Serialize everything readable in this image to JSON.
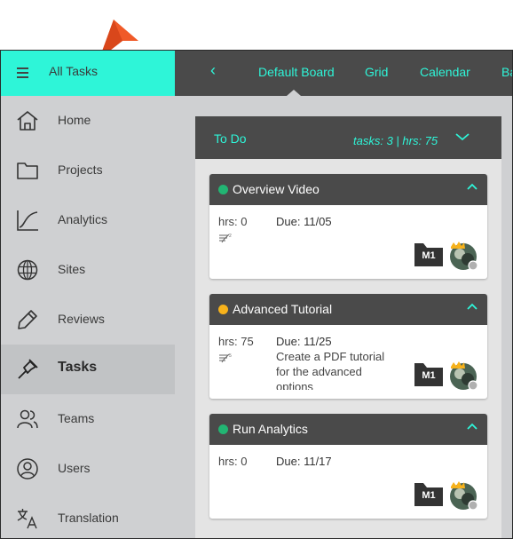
{
  "header": {
    "title": "All Tasks",
    "back_glyph": "‹",
    "tabs": [
      {
        "label": "Default Board"
      },
      {
        "label": "Grid"
      },
      {
        "label": "Calendar"
      },
      {
        "label": "Ba"
      }
    ]
  },
  "sidebar": {
    "items": [
      {
        "label": "Home",
        "icon": "home-icon"
      },
      {
        "label": "Projects",
        "icon": "folder-icon"
      },
      {
        "label": "Analytics",
        "icon": "chart-icon"
      },
      {
        "label": "Sites",
        "icon": "globe-icon"
      },
      {
        "label": "Reviews",
        "icon": "pencil-icon"
      },
      {
        "label": "Tasks",
        "icon": "pin-icon"
      },
      {
        "label": "Teams",
        "icon": "users-icon"
      },
      {
        "label": "Users",
        "icon": "user-circle-icon"
      },
      {
        "label": "Translation",
        "icon": "translate-icon"
      }
    ],
    "active": "Tasks"
  },
  "column": {
    "title": "To Do",
    "stats": "tasks: 3 | hrs: 75"
  },
  "cards": [
    {
      "title": "Overview Video",
      "status_color": "#22b573",
      "hrs": "hrs: 0",
      "due": "Due: 11/05",
      "description": "",
      "badge": "M1"
    },
    {
      "title": "Advanced Tutorial",
      "status_color": "#f7b21b",
      "hrs": "hrs: 75",
      "due": "Due: 11/25",
      "description": "Create a PDF tutorial for the advanced options",
      "badge": "M1"
    },
    {
      "title": "Run Analytics",
      "status_color": "#22b573",
      "hrs": "hrs: 0",
      "due": "Due: 11/17",
      "description": "",
      "badge": "M1"
    }
  ],
  "colors": {
    "accent": "#2ef5d8",
    "header_dark": "#4a4a4a",
    "pointer": "#f05a28",
    "crown": "#f7b21b"
  }
}
